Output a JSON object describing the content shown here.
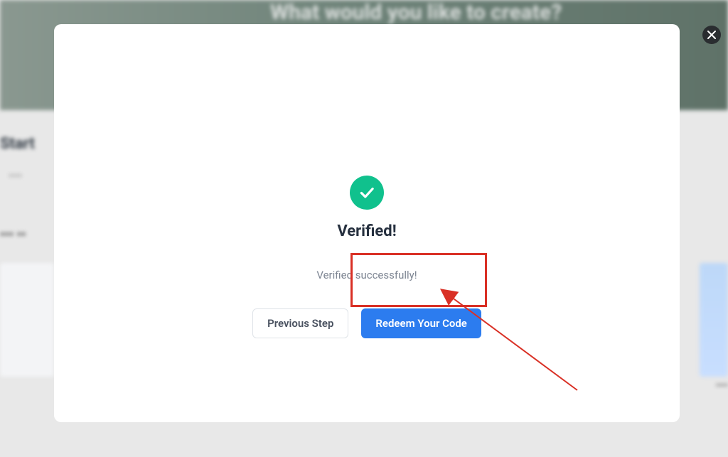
{
  "background": {
    "hero_heading": "What would you like to create?",
    "start_text": "Start",
    "sub_text": "••••",
    "section_text": "••• ••",
    "right_card_label": "••••"
  },
  "modal": {
    "title": "Verified!",
    "subtitle": "Verified successfully!",
    "prev_label": "Previous Step",
    "redeem_label": "Redeem Your Code"
  },
  "icons": {
    "check": "check-icon",
    "close": "close-icon"
  },
  "colors": {
    "primary": "#2c7cef",
    "success": "#10c18d",
    "danger": "#d93025"
  }
}
